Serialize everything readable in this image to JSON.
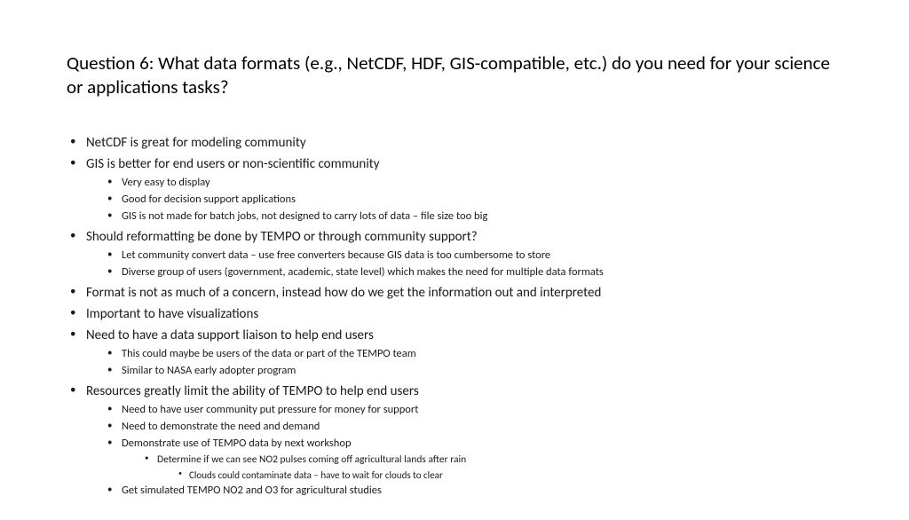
{
  "title": "Question 6:  What data formats (e.g., NetCDF, HDF, GIS-compatible, etc.) do you need for your science or applications tasks?",
  "b1": "NetCDF is great for modeling community",
  "b2": "GIS is better for end users or non-scientific community",
  "b2_1": "Very easy to display",
  "b2_2": "Good for decision support applications",
  "b2_3": "GIS is not made for batch jobs, not designed to carry lots of data – file size too big",
  "b3": "Should reformatting be done by TEMPO or through community support?",
  "b3_1": "Let community convert data – use free converters because GIS data is too cumbersome to store",
  "b3_2": "Diverse group of users (government, academic, state level) which makes the need for multiple data formats",
  "b4": "Format is not as much of a concern, instead how do we get the information out and interpreted",
  "b5": "Important to have visualizations",
  "b6": "Need to have a data support liaison to help end users",
  "b6_1": "This could maybe be users of the data or part of the TEMPO team",
  "b6_2": "Similar to NASA early adopter program",
  "b7": "Resources greatly limit the ability of TEMPO to help end users",
  "b7_1": "Need to have user community put pressure for money for support",
  "b7_2": "Need to demonstrate the need and demand",
  "b7_3": "Demonstrate use of TEMPO data by next workshop",
  "b7_3_1": "Determine if we can see NO2 pulses coming off agricultural lands after rain",
  "b7_3_1_1": "Clouds could contaminate data – have to wait for clouds to clear",
  "b7_4": "Get simulated TEMPO NO2 and O3 for agricultural studies"
}
